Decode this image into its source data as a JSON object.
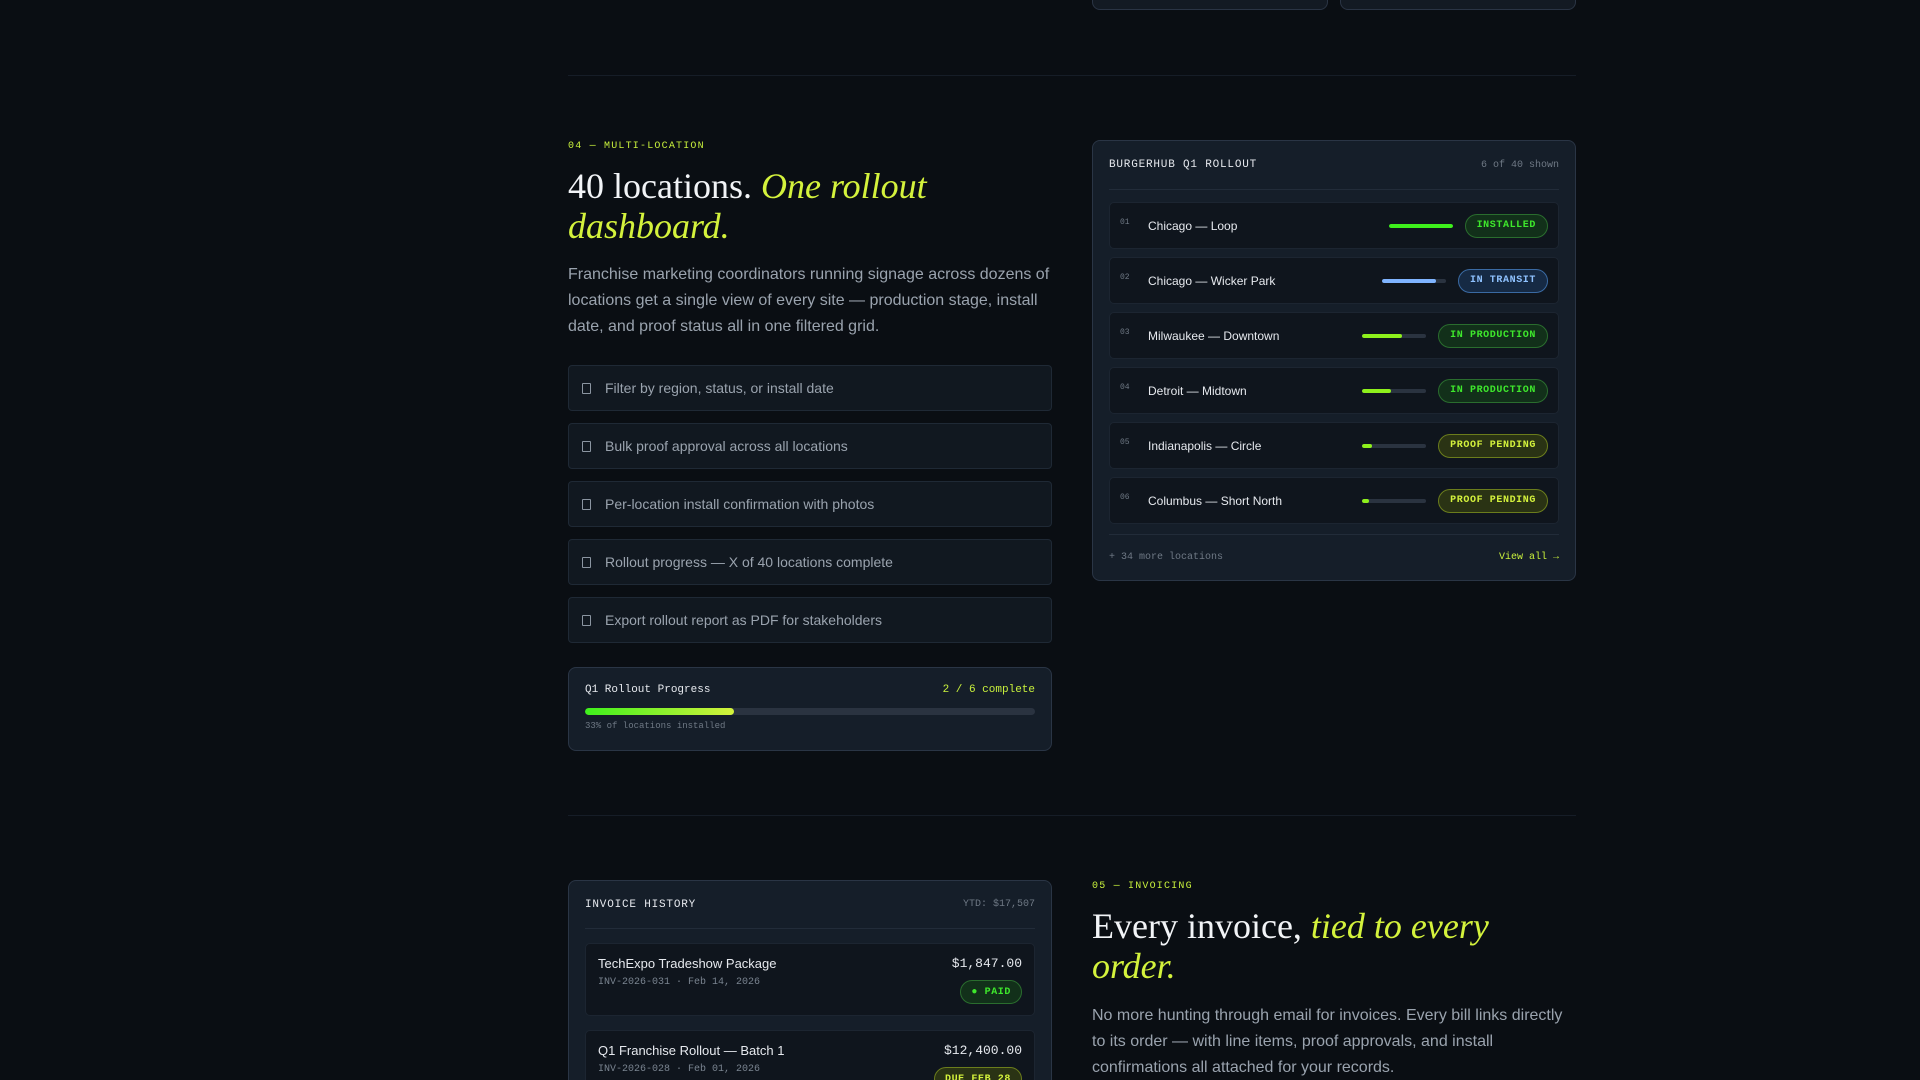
{
  "section_multi_location": {
    "eyebrow": "04 — MULTI-LOCATION",
    "headline_plain": "40 locations.",
    "headline_accent": "One rollout dashboard.",
    "lead": "Franchise marketing coordinators running signage across dozens of locations get a single view of every site — production stage, install date, and proof status all in one filtered grid.",
    "features": [
      "Filter by region, status, or install date",
      "Bulk proof approval across all locations",
      "Per-location install confirmation with photos",
      "Rollout progress — X of 40 locations complete",
      "Export rollout report as PDF for stakeholders"
    ],
    "progress": {
      "title": "Q1 Rollout Progress",
      "count": "2 / 6 complete",
      "percent": 33,
      "note": "33% of locations installed"
    }
  },
  "rollout_card": {
    "title": "BURGERHUB Q1 ROLLOUT",
    "shown": "6 of 40 shown",
    "locations": [
      {
        "num": "01",
        "name": "Chicago — Loop",
        "progress": 1.0,
        "status": "INSTALLED",
        "tone": "green"
      },
      {
        "num": "02",
        "name": "Chicago — Wicker Park",
        "progress": 0.85,
        "status": "IN TRANSIT",
        "tone": "blue"
      },
      {
        "num": "03",
        "name": "Milwaukee — Downtown",
        "progress": 0.62,
        "status": "IN PRODUCTION",
        "tone": "green"
      },
      {
        "num": "04",
        "name": "Detroit — Midtown",
        "progress": 0.45,
        "status": "IN PRODUCTION",
        "tone": "green"
      },
      {
        "num": "05",
        "name": "Indianapolis — Circle",
        "progress": 0.15,
        "status": "PROOF PENDING",
        "tone": "yellow"
      },
      {
        "num": "06",
        "name": "Columbus — Short North",
        "progress": 0.1,
        "status": "PROOF PENDING",
        "tone": "yellow"
      }
    ],
    "more": "+ 34 more locations",
    "view_all": "View all →"
  },
  "section_invoicing": {
    "eyebrow": "05 — INVOICING",
    "headline_plain": "Every invoice,",
    "headline_accent": "tied to every order.",
    "lead": "No more hunting through email for invoices. Every bill links directly to its order — with line items, proof approvals, and install confirmations all attached for your records."
  },
  "invoice_card": {
    "title": "INVOICE HISTORY",
    "ytd": "YTD: $17,507",
    "invoices": [
      {
        "name": "TechExpo Tradeshow Package",
        "meta": "INV-2026-031 · Feb 14, 2026",
        "amount": "$1,847.00",
        "status": "● PAID",
        "tone": "green"
      },
      {
        "name": "Q1 Franchise Rollout — Batch 1",
        "meta": "INV-2026-028 · Feb 01, 2026",
        "amount": "$12,400.00",
        "status": "DUE FEB 28",
        "tone": "yellow"
      }
    ]
  },
  "colors": {
    "background": "#0a0e13",
    "accent": "#d4f23c",
    "green": "#3ee82c",
    "blue": "#8fc2ff"
  }
}
